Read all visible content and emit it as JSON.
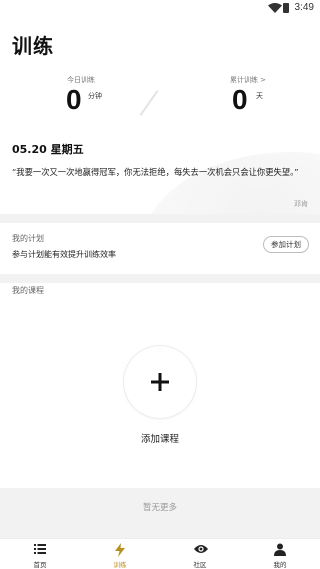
{
  "status": {
    "time": "3:49"
  },
  "title": "训练",
  "stats": {
    "today_label": "今日训练",
    "today_value": "0",
    "today_unit": "分钟",
    "total_label": "累计训练 >",
    "total_value": "0",
    "total_unit": "天"
  },
  "date": "05.20 星期五",
  "quote": {
    "text": "“我要一次又一次地赢得冠军，你无法拒绝，每失去一次机会只会让你更失望。”",
    "author": "邓肯"
  },
  "plan": {
    "title": "我的计划",
    "description": "参与计划能有效提升训练效率",
    "join_label": "参加计划"
  },
  "course": {
    "title": "我的课程",
    "add_label": "添加课程"
  },
  "no_more": "暂无更多",
  "tabs": [
    {
      "label": "首页",
      "icon": "list-icon"
    },
    {
      "label": "训练",
      "icon": "lightning-icon",
      "active": true
    },
    {
      "label": "社区",
      "icon": "eye-icon"
    },
    {
      "label": "我的",
      "icon": "person-icon"
    }
  ],
  "colors": {
    "accent": "#b8901f",
    "background": "#ffffff",
    "separator": "#f2f2f2"
  }
}
